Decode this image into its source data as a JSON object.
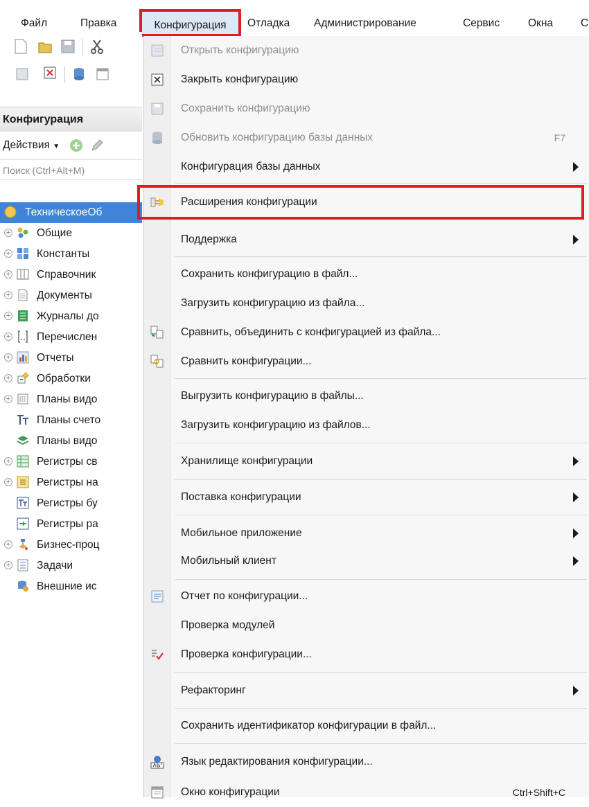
{
  "menubar": {
    "items": [
      {
        "label": "Файл"
      },
      {
        "label": "Правка"
      },
      {
        "label": "Конфигурация"
      },
      {
        "label": "Отладка"
      },
      {
        "label": "Администрирование"
      },
      {
        "label": "Сервис"
      },
      {
        "label": "Окна"
      },
      {
        "label": "С"
      }
    ]
  },
  "left_panel": {
    "title": "Конфигурация",
    "actions_label": "Действия",
    "search_placeholder": "Поиск (Ctrl+Alt+M)",
    "tree": [
      {
        "label": "ТехническоеОб",
        "icon": "config-root-icon",
        "selected": true
      },
      {
        "label": "Общие",
        "icon": "common-icon"
      },
      {
        "label": "Константы",
        "icon": "constants-icon"
      },
      {
        "label": "Справочник",
        "icon": "catalogs-icon"
      },
      {
        "label": "Документы",
        "icon": "documents-icon"
      },
      {
        "label": "Журналы до",
        "icon": "journals-icon"
      },
      {
        "label": "Перечислен",
        "icon": "enums-icon"
      },
      {
        "label": "Отчеты",
        "icon": "reports-icon"
      },
      {
        "label": "Обработки",
        "icon": "dataprocessors-icon"
      },
      {
        "label": "Планы видо",
        "icon": "chart-types-icon"
      },
      {
        "label": "Планы счето",
        "icon": "chart-accounts-icon"
      },
      {
        "label": "Планы видо",
        "icon": "calc-types-icon"
      },
      {
        "label": "Регистры св",
        "icon": "info-registers-icon"
      },
      {
        "label": "Регистры на",
        "icon": "accum-registers-icon"
      },
      {
        "label": "Регистры бу",
        "icon": "accounting-registers-icon"
      },
      {
        "label": "Регистры ра",
        "icon": "calc-registers-icon"
      },
      {
        "label": "Бизнес-проц",
        "icon": "business-processes-icon"
      },
      {
        "label": "Задачи",
        "icon": "tasks-icon"
      },
      {
        "label": "Внешние ис",
        "icon": "external-sources-icon"
      }
    ]
  },
  "menu": {
    "items": [
      {
        "label": "Открыть конфигурацию",
        "disabled": true,
        "icon": "open-config-icon"
      },
      {
        "label": "Закрыть конфигурацию",
        "icon": "close-config-icon"
      },
      {
        "label": "Сохранить конфигурацию",
        "disabled": true,
        "icon": "save-config-icon"
      },
      {
        "label": "Обновить конфигурацию базы данных",
        "disabled": true,
        "shortcut": "F7",
        "icon": "update-db-icon"
      },
      {
        "label": "Конфигурация базы данных",
        "submenu": true
      },
      {
        "label": "Расширения конфигурации",
        "icon": "extensions-icon",
        "highlighted": true
      },
      {
        "label": "Поддержка",
        "submenu": true
      },
      {
        "label": "Сохранить конфигурацию в файл..."
      },
      {
        "label": "Загрузить конфигурацию из файла..."
      },
      {
        "label": "Сравнить, объединить с конфигурацией из файла...",
        "icon": "compare-merge-icon"
      },
      {
        "label": "Сравнить конфигурации...",
        "icon": "compare-icon"
      },
      {
        "label": "Выгрузить конфигурацию в файлы..."
      },
      {
        "label": "Загрузить конфигурацию из файлов..."
      },
      {
        "label": "Хранилище конфигурации",
        "submenu": true
      },
      {
        "label": "Поставка конфигурации",
        "submenu": true
      },
      {
        "label": "Мобильное приложение",
        "submenu": true
      },
      {
        "label": "Мобильный клиент",
        "submenu": true
      },
      {
        "label": "Отчет по конфигурации...",
        "icon": "report-icon"
      },
      {
        "label": "Проверка модулей"
      },
      {
        "label": "Проверка конфигурации...",
        "icon": "check-config-icon"
      },
      {
        "label": "Рефакторинг",
        "submenu": true
      },
      {
        "label": "Сохранить идентификатор конфигурации в файл..."
      },
      {
        "label": "Язык редактирования конфигурации...",
        "icon": "language-icon"
      },
      {
        "label": "Окно конфигурации",
        "shortcut": "Ctrl+Shift+C",
        "icon": "config-window-icon"
      }
    ]
  },
  "colors": {
    "highlight_border": "#e01b24",
    "selection": "#3f84d8",
    "menu_bg": "#f7f7f7"
  }
}
